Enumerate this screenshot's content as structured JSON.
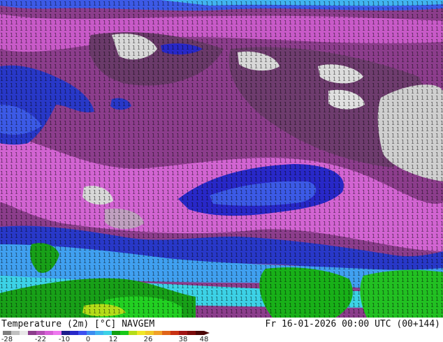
{
  "map": {
    "title_parameter": "Temperature (2m) [°C]",
    "model": "NAVGEM",
    "valid_time": "Fr 16-01-2026 00:00 UTC (00+144)"
  },
  "legend": {
    "ticks": [
      "-28",
      "-22",
      "-10",
      "0",
      "12",
      "26",
      "38",
      "48"
    ],
    "colors": [
      "#7f7f7f",
      "#bfbfbf",
      "#e8e8e8",
      "#8c3d8c",
      "#b34fb3",
      "#d65fd6",
      "#ee77ee",
      "#1e1e8c",
      "#2828c8",
      "#3c50f0",
      "#3c8cf0",
      "#40b4f0",
      "#3cd2e6",
      "#10a010",
      "#18c818",
      "#b4dc18",
      "#f0e628",
      "#f0c828",
      "#f0a028",
      "#e06418",
      "#c83214",
      "#a01414",
      "#7a0a0a",
      "#4a0606"
    ]
  },
  "colors": {
    "very_cold": "#5a3a5a",
    "cold_purple": "#8c3d8c",
    "magenta": "#d264d2",
    "dark_blue": "#1e1ea0",
    "blue": "#3c5ae6",
    "light_blue": "#4ab4f0",
    "cyan": "#3cdcf0",
    "green": "#18a018",
    "bright_green": "#22d022",
    "gray": "#d8d8d8"
  }
}
